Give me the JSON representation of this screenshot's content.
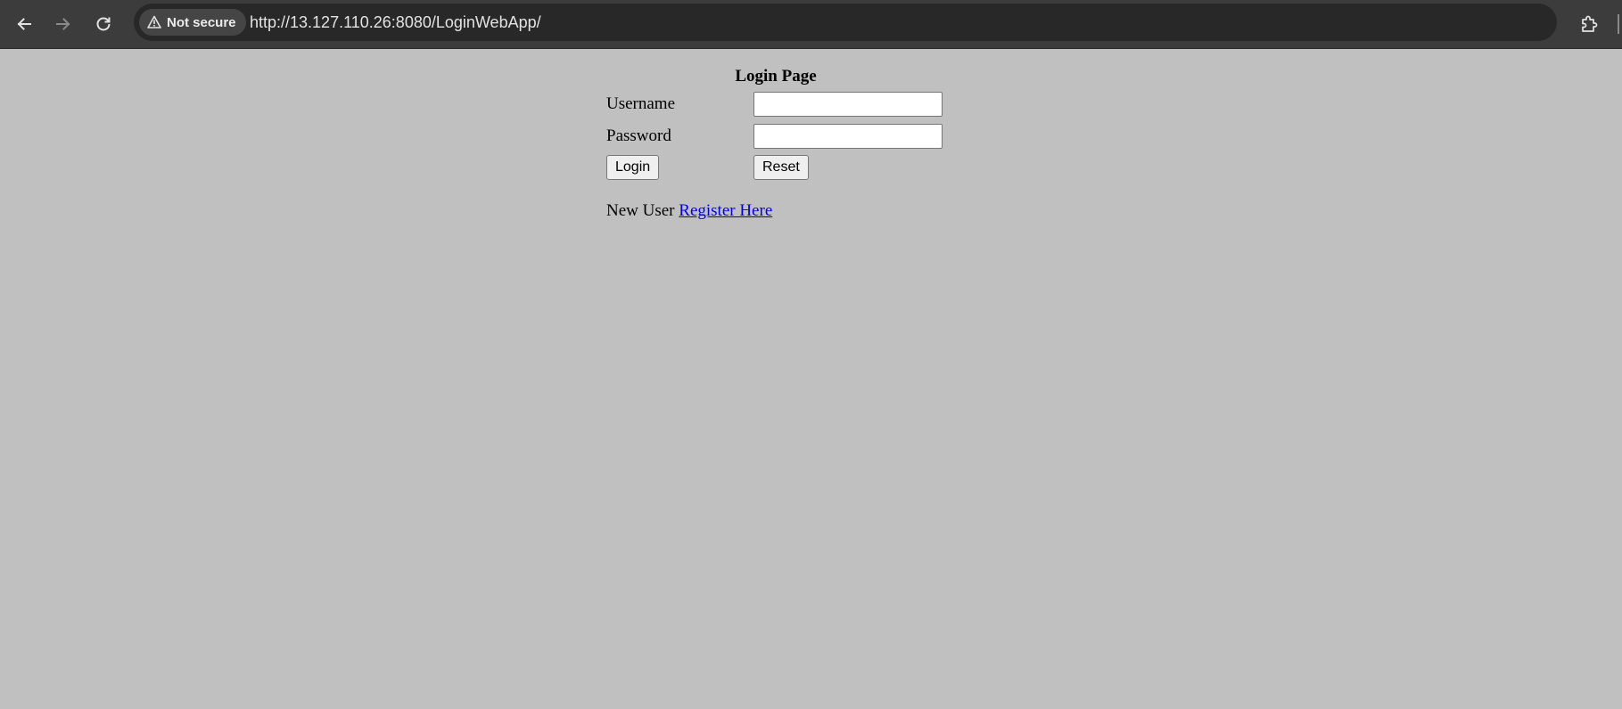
{
  "browser": {
    "security_label": "Not secure",
    "url": "http://13.127.110.26:8080/LoginWebApp/"
  },
  "icons": {
    "back": "arrow-left",
    "forward": "arrow-right",
    "reload": "reload",
    "security": "warning-triangle",
    "bookmark": "star",
    "extensions": "puzzle-piece"
  },
  "login_form": {
    "title": "Login Page",
    "username_label": "Username",
    "username_value": "",
    "password_label": "Password",
    "password_value": "",
    "login_button": "Login",
    "reset_button": "Reset",
    "new_user_text": "New User",
    "register_link": "Register Here"
  },
  "colors": {
    "page_background": "#c0c0c0",
    "toolbar_background": "#3c3c3c",
    "omnibox_background": "#282828",
    "link": "#0000ee"
  }
}
